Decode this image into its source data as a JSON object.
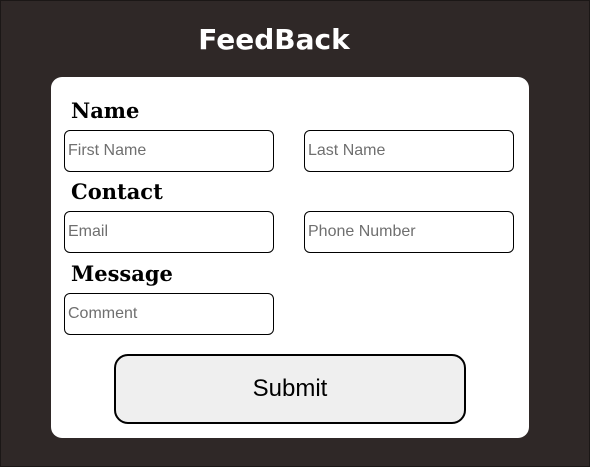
{
  "page": {
    "title": "FeedBack"
  },
  "form": {
    "name_label": "Name",
    "contact_label": "Contact",
    "message_label": "Message",
    "first_name": {
      "placeholder": "First Name",
      "value": ""
    },
    "last_name": {
      "placeholder": "Last Name",
      "value": ""
    },
    "email": {
      "placeholder": "Email",
      "value": ""
    },
    "phone": {
      "placeholder": "Phone Number",
      "value": ""
    },
    "comment": {
      "placeholder": "Comment",
      "value": ""
    },
    "submit_label": "Submit"
  },
  "colors": {
    "background": "#2f2827",
    "card": "#ffffff",
    "button": "#efefef",
    "title_text": "#ffffff"
  }
}
